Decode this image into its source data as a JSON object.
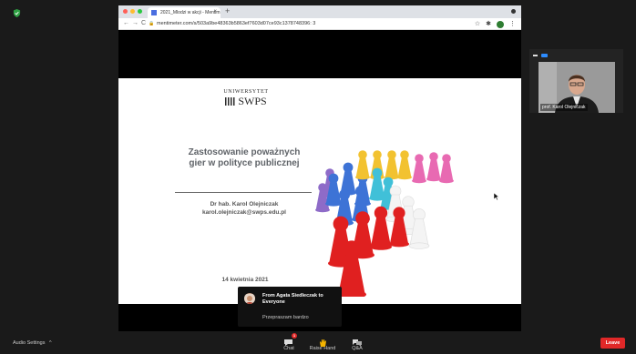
{
  "browser": {
    "tab_title": "2021_Mlodzi w akcji - Mentim",
    "tab_close": "×",
    "new_tab": "+",
    "url": "mentimeter.com/s/503a9be48363b5863ef7603d07ce93c1378748396: 3",
    "back": "←",
    "forward": "→",
    "reload": "C",
    "lock": "🔒",
    "star": "☆",
    "extension": "✱",
    "menu": "⋮"
  },
  "slide": {
    "university_top": "UNIWERSYTET",
    "university_name": "SWPS",
    "title": "Zastosowanie poważnych gier w polityce publicznej",
    "author_name": "Dr hab. Karol Olejniczak",
    "author_email": "karol.olejniczak@swps.edu.pl",
    "date": "14 kwietnia 2021"
  },
  "participant": {
    "name": "prof. Karol Olejniczak"
  },
  "chat_toast": {
    "from": "From Agata Siedleczak to Everyone",
    "message": "Przepraszam bardzo"
  },
  "toolbar": {
    "audio_settings": "Audio Settings",
    "audio_caret": "^",
    "chat_label": "Chat",
    "chat_badge": "1",
    "raise_hand_label": "Raise Hand",
    "qa_label": "Q&A",
    "leave_label": "Leave"
  },
  "colors": {
    "zoom_blue": "#2d8cff",
    "leave_red": "#e02828",
    "shield_green": "#2ea043"
  }
}
